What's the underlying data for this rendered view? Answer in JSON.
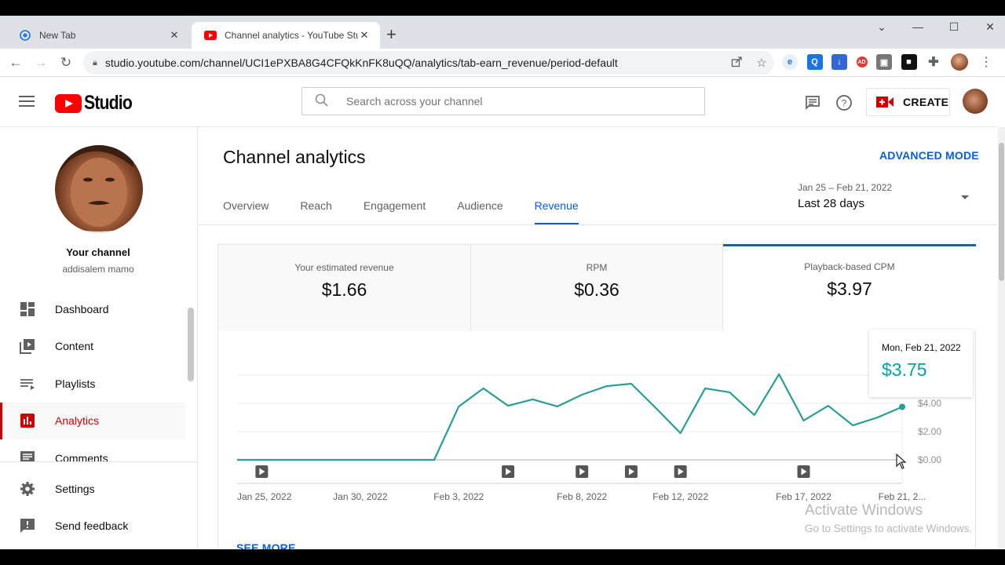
{
  "browser": {
    "tabs": [
      {
        "title": "New Tab",
        "icon": "browser-newtab-icon",
        "active": false
      },
      {
        "title": "Channel analytics - YouTube Studio",
        "icon": "youtube-icon",
        "active": true
      }
    ],
    "new_tab_glyph": "+",
    "url": "studio.youtube.com/channel/UCI1ePXBA8G4CFQkKnFK8uQQ/analytics/tab-earn_revenue/period-default",
    "window_controls": [
      "chevron-down",
      "minimize",
      "maximize",
      "close"
    ]
  },
  "header": {
    "logo_text": "Studio",
    "search_placeholder": "Search across your channel",
    "create_label": "CREATE"
  },
  "sidebar": {
    "channel_title": "Your channel",
    "channel_name": "addisalem mamo",
    "items": [
      {
        "label": "Dashboard",
        "icon": "dashboard-icon",
        "active": false
      },
      {
        "label": "Content",
        "icon": "content-icon",
        "active": false
      },
      {
        "label": "Playlists",
        "icon": "playlists-icon",
        "active": false
      },
      {
        "label": "Analytics",
        "icon": "analytics-icon",
        "active": true
      },
      {
        "label": "Comments",
        "icon": "comments-icon",
        "active": false
      }
    ],
    "bottom_items": [
      {
        "label": "Settings",
        "icon": "gear-icon"
      },
      {
        "label": "Send feedback",
        "icon": "feedback-icon"
      }
    ]
  },
  "main": {
    "title": "Channel analytics",
    "advanced_mode": "ADVANCED MODE",
    "tabs": [
      {
        "label": "Overview",
        "active": false
      },
      {
        "label": "Reach",
        "active": false
      },
      {
        "label": "Engagement",
        "active": false
      },
      {
        "label": "Audience",
        "active": false
      },
      {
        "label": "Revenue",
        "active": true
      }
    ],
    "date_range": "Jan 25 – Feb 21, 2022",
    "period": "Last 28 days",
    "metrics": [
      {
        "label": "Your estimated revenue",
        "value": "$1.66"
      },
      {
        "label": "RPM",
        "value": "$0.36"
      },
      {
        "label": "Playback-based CPM",
        "value": "$3.97",
        "selected": true
      }
    ],
    "tooltip": {
      "date": "Mon, Feb 21, 2022",
      "value": "$3.75"
    },
    "see_more": "SEE MORE"
  },
  "watermark": {
    "line1": "Activate Windows",
    "line2": "Go to Settings to activate Windows."
  },
  "colors": {
    "accent_blue": "#065fd4",
    "line_teal": "#2a9d94",
    "tooltip_teal": "#00a3a0",
    "brand_red": "#ff0000",
    "active_red": "#cc0000"
  },
  "chart_data": {
    "type": "line",
    "title": "Playback-based CPM",
    "xlabel": "",
    "ylabel": "",
    "x": [
      "Jan 25",
      "Jan 26",
      "Jan 27",
      "Jan 28",
      "Jan 29",
      "Jan 30",
      "Jan 31",
      "Feb 1",
      "Feb 2",
      "Feb 3",
      "Feb 4",
      "Feb 5",
      "Feb 6",
      "Feb 7",
      "Feb 8",
      "Feb 9",
      "Feb 10",
      "Feb 11",
      "Feb 12",
      "Feb 13",
      "Feb 14",
      "Feb 15",
      "Feb 16",
      "Feb 17",
      "Feb 18",
      "Feb 19",
      "Feb 20",
      "Feb 21"
    ],
    "series": [
      {
        "name": "Playback-based CPM",
        "values": [
          0,
          0,
          0,
          0,
          0,
          0,
          0,
          0,
          0,
          3.78,
          5.06,
          3.83,
          4.28,
          3.78,
          4.61,
          5.22,
          5.39,
          3.67,
          1.89,
          5.06,
          4.78,
          3.17,
          6.06,
          2.78,
          3.83,
          2.44,
          3.0,
          3.75
        ]
      }
    ],
    "ylim": [
      0,
      6
    ],
    "yticks": [
      "$0.00",
      "$2.00",
      "$4.00"
    ],
    "ytick_values": [
      0,
      2,
      4
    ],
    "gridlines_at": [
      2,
      4,
      6
    ],
    "xtick_labels": [
      "Jan 25, 2022",
      "Jan 30, 2022",
      "Feb 3, 2022",
      "Feb 8, 2022",
      "Feb 12, 2022",
      "Feb 17, 2022",
      "Feb 21, 2..."
    ],
    "xtick_indices": [
      0,
      5,
      9,
      14,
      18,
      23,
      27
    ],
    "video_markers_indices": [
      1,
      11,
      14,
      16,
      18,
      23
    ],
    "highlighted_index": 27,
    "grid": true,
    "y_axis_side": "right"
  }
}
